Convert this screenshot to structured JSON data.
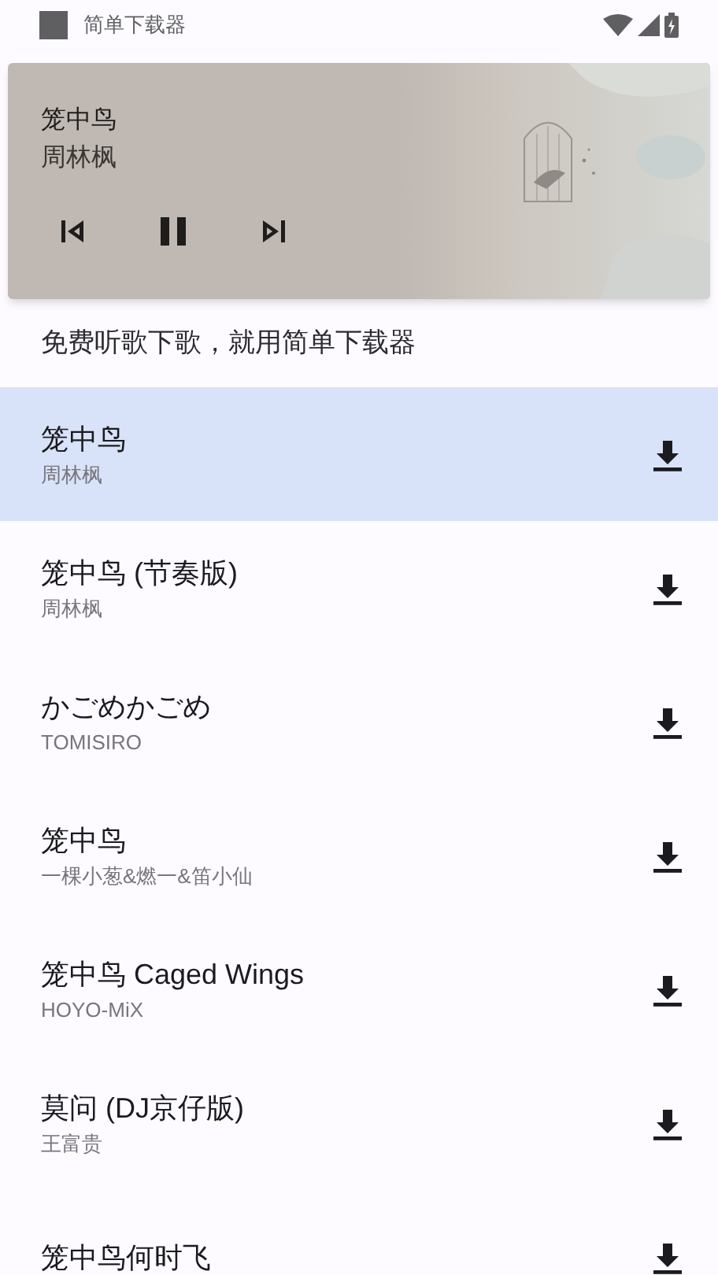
{
  "status_bar": {
    "app_name": "简单下载器"
  },
  "player": {
    "title": "笼中鸟",
    "artist": "周林枫",
    "playing": true
  },
  "tagline": "免费听歌下歌，就用简单下载器",
  "songs": [
    {
      "title": "笼中鸟",
      "artist": "周林枫",
      "selected": true
    },
    {
      "title": "笼中鸟 (节奏版)",
      "artist": "周林枫",
      "selected": false
    },
    {
      "title": "かごめかごめ",
      "artist": "TOMISIRO",
      "selected": false
    },
    {
      "title": "笼中鸟",
      "artist": "一棵小葱&燃一&笛小仙",
      "selected": false
    },
    {
      "title": "笼中鸟 Caged Wings",
      "artist": "HOYO-MiX",
      "selected": false
    },
    {
      "title": "莫问 (DJ京仔版)",
      "artist": "王富贵",
      "selected": false
    },
    {
      "title": "笼中鸟何时飞",
      "selected": false
    }
  ]
}
